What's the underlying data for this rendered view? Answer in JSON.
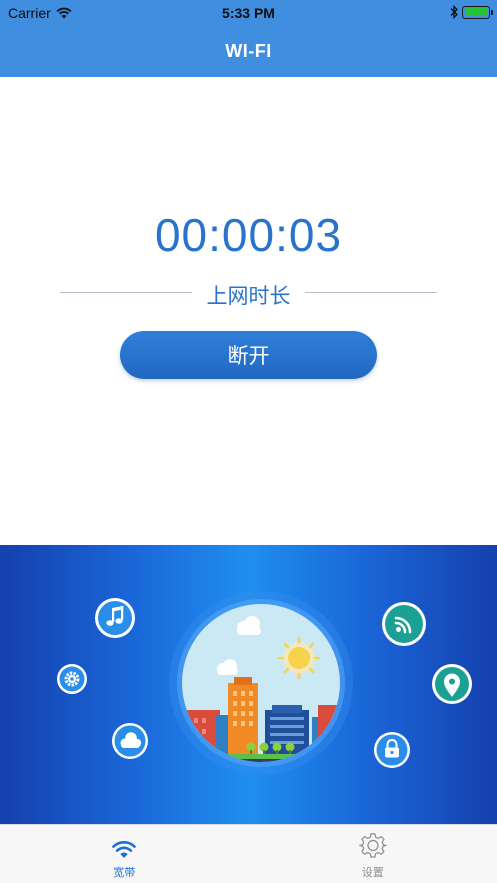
{
  "status_bar": {
    "carrier": "Carrier",
    "time": "5:33 PM",
    "battery_level": 1.0,
    "icons": [
      "wifi-signal-icon",
      "bluetooth-icon",
      "battery-icon"
    ]
  },
  "nav": {
    "title": "WI-FI"
  },
  "timer": {
    "elapsed": "00:00:03",
    "label": "上网时长"
  },
  "actions": {
    "disconnect_label": "断开"
  },
  "illustration": {
    "icons": [
      "music-icon",
      "gear-icon",
      "cloud-icon",
      "wifi-icon",
      "location-pin-icon",
      "lock-icon"
    ],
    "scene": "city-skyline-globe"
  },
  "tab_bar": {
    "tabs": [
      {
        "label": "宽带",
        "icon": "wifi-tab-icon",
        "active": true
      },
      {
        "label": "设置",
        "icon": "settings-gear-icon",
        "active": false
      }
    ]
  },
  "colors": {
    "nav_blue": "#3f8ee0",
    "accent_blue": "#2a73cc",
    "tab_active": "#1c6fd6",
    "tab_inactive": "#8e8e93",
    "battery_green": "#26c33a"
  }
}
